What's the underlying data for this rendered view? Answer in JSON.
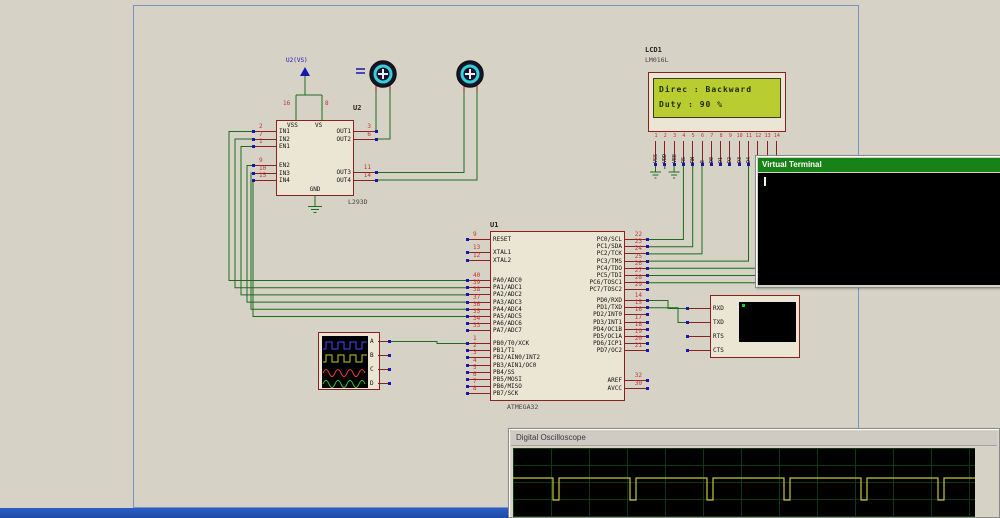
{
  "canvas": {
    "power_flag": "U2(VS)"
  },
  "driver": {
    "ref": "U2",
    "part": "L293D",
    "in_a": [
      {
        "n": "2",
        "name": "IN1"
      },
      {
        "n": "7",
        "name": "IN2"
      },
      {
        "n": "1",
        "name": "EN1"
      }
    ],
    "in_b": [
      {
        "n": "9",
        "name": "EN2"
      },
      {
        "n": "10",
        "name": "IN3"
      },
      {
        "n": "15",
        "name": "IN4"
      }
    ],
    "out_a": [
      {
        "n": "3",
        "name": "OUT1"
      },
      {
        "n": "6",
        "name": "OUT2"
      }
    ],
    "out_b": [
      {
        "n": "11",
        "name": "OUT3"
      },
      {
        "n": "14",
        "name": "OUT4"
      }
    ],
    "pin_vss": {
      "n": "16",
      "name": "VSS"
    },
    "pin_vs": {
      "n": "8",
      "name": "VS"
    },
    "pin_gnd": "GND"
  },
  "mcu": {
    "ref": "U1",
    "part": "ATMEGA32",
    "reset": [
      {
        "n": "9",
        "name": "RESET"
      }
    ],
    "xtal": [
      {
        "n": "13",
        "name": "XTAL1"
      },
      {
        "n": "12",
        "name": "XTAL2"
      }
    ],
    "porta": [
      {
        "n": "40",
        "name": "PA0/ADC0"
      },
      {
        "n": "39",
        "name": "PA1/ADC1"
      },
      {
        "n": "38",
        "name": "PA2/ADC2"
      },
      {
        "n": "37",
        "name": "PA3/ADC3"
      },
      {
        "n": "36",
        "name": "PA4/ADC4"
      },
      {
        "n": "35",
        "name": "PA5/ADC5"
      },
      {
        "n": "34",
        "name": "PA6/ADC6"
      },
      {
        "n": "33",
        "name": "PA7/ADC7"
      }
    ],
    "portb": [
      {
        "n": "1",
        "name": "PB0/T0/XCK"
      },
      {
        "n": "2",
        "name": "PB1/T1"
      },
      {
        "n": "3",
        "name": "PB2/AIN0/INT2"
      },
      {
        "n": "4",
        "name": "PB3/AIN1/OC0"
      },
      {
        "n": "5",
        "name": "PB4/SS"
      },
      {
        "n": "6",
        "name": "PB5/MOSI"
      },
      {
        "n": "7",
        "name": "PB6/MISO"
      },
      {
        "n": "8",
        "name": "PB7/SCK"
      }
    ],
    "portc": [
      {
        "n": "22",
        "name": "PC0/SCL"
      },
      {
        "n": "23",
        "name": "PC1/SDA"
      },
      {
        "n": "24",
        "name": "PC2/TCK"
      },
      {
        "n": "25",
        "name": "PC3/TMS"
      },
      {
        "n": "26",
        "name": "PC4/TDO"
      },
      {
        "n": "27",
        "name": "PC5/TDI"
      },
      {
        "n": "28",
        "name": "PC6/TOSC1"
      },
      {
        "n": "29",
        "name": "PC7/TOSC2"
      }
    ],
    "portd": [
      {
        "n": "14",
        "name": "PD0/RXD"
      },
      {
        "n": "15",
        "name": "PD1/TXD"
      },
      {
        "n": "16",
        "name": "PD2/INT0"
      },
      {
        "n": "17",
        "name": "PD3/INT1"
      },
      {
        "n": "18",
        "name": "PD4/OC1B"
      },
      {
        "n": "19",
        "name": "PD5/OC1A"
      },
      {
        "n": "20",
        "name": "PD6/ICP1"
      },
      {
        "n": "21",
        "name": "PD7/OC2"
      }
    ],
    "power": [
      {
        "n": "32",
        "name": "AREF"
      },
      {
        "n": "30",
        "name": "AVCC"
      }
    ]
  },
  "lcd": {
    "ref": "LCD1",
    "part": "LM016L",
    "line1": "Direc : Backward",
    "line2": "Duty : 90 %",
    "pins": [
      {
        "n": "1",
        "name": "VSS"
      },
      {
        "n": "2",
        "name": "VDD"
      },
      {
        "n": "3",
        "name": "VEE"
      },
      {
        "n": "4",
        "name": "RS"
      },
      {
        "n": "5",
        "name": "RW"
      },
      {
        "n": "6",
        "name": "E"
      },
      {
        "n": "7",
        "name": "D0"
      },
      {
        "n": "8",
        "name": "D1"
      },
      {
        "n": "9",
        "name": "D2"
      },
      {
        "n": "10",
        "name": "D3"
      },
      {
        "n": "11",
        "name": "D4"
      },
      {
        "n": "12",
        "name": "D5"
      },
      {
        "n": "13",
        "name": "D6"
      },
      {
        "n": "14",
        "name": "D7"
      }
    ]
  },
  "terminal_component": {
    "pins": [
      {
        "name": "RXD"
      },
      {
        "name": "TXD"
      },
      {
        "name": "RTS"
      },
      {
        "name": "CTS"
      }
    ]
  },
  "scope_component": {
    "channels": [
      "A",
      "B",
      "C",
      "D"
    ]
  },
  "virtual_terminal": {
    "title": "Virtual Terminal"
  },
  "oscilloscope": {
    "title": "Digital Oscilloscope"
  },
  "colors": {
    "wire": "#1e6b1e",
    "stub": "#8a2020",
    "pinnum": "#c23232",
    "square": "#1616b2",
    "chip": "#eae6d3",
    "chipborder": "#8a2020",
    "canvas": "#d6d3c6",
    "lcdbg": "#b9cc30",
    "lcdtext": "#1f2b00",
    "vtgreen": "#178317",
    "scopetrace": "#c8c832",
    "taskbar": "#2b5fc6"
  }
}
